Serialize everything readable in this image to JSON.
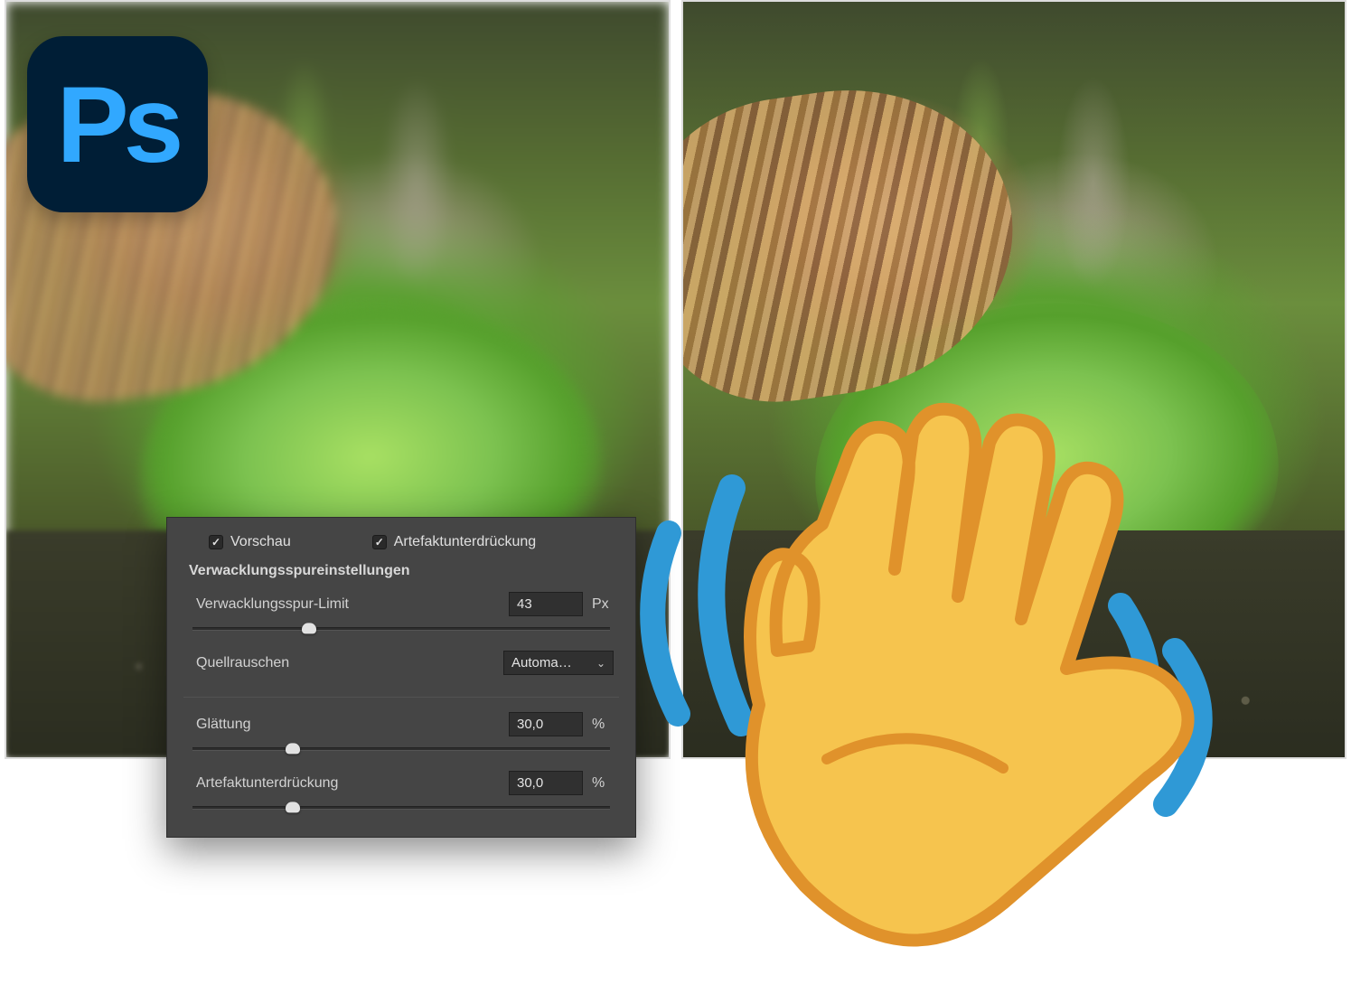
{
  "app_logo_text": "Ps",
  "dialog": {
    "preview_label": "Vorschau",
    "artifact_checkbox_label": "Artefaktunterdrückung",
    "section_title": "Verwacklungsspureinstellungen",
    "blur_trace": {
      "label": "Verwacklungsspur-Limit",
      "value": "43",
      "unit": "Px",
      "slider_pct": 28
    },
    "source_noise": {
      "label": "Quellrauschen",
      "selected": "Automa…"
    },
    "smoothing": {
      "label": "Glättung",
      "value": "30,0",
      "unit": "%",
      "slider_pct": 24
    },
    "artifact_suppression": {
      "label": "Artefaktunterdrückung",
      "value": "30,0",
      "unit": "%",
      "slider_pct": 24
    }
  }
}
